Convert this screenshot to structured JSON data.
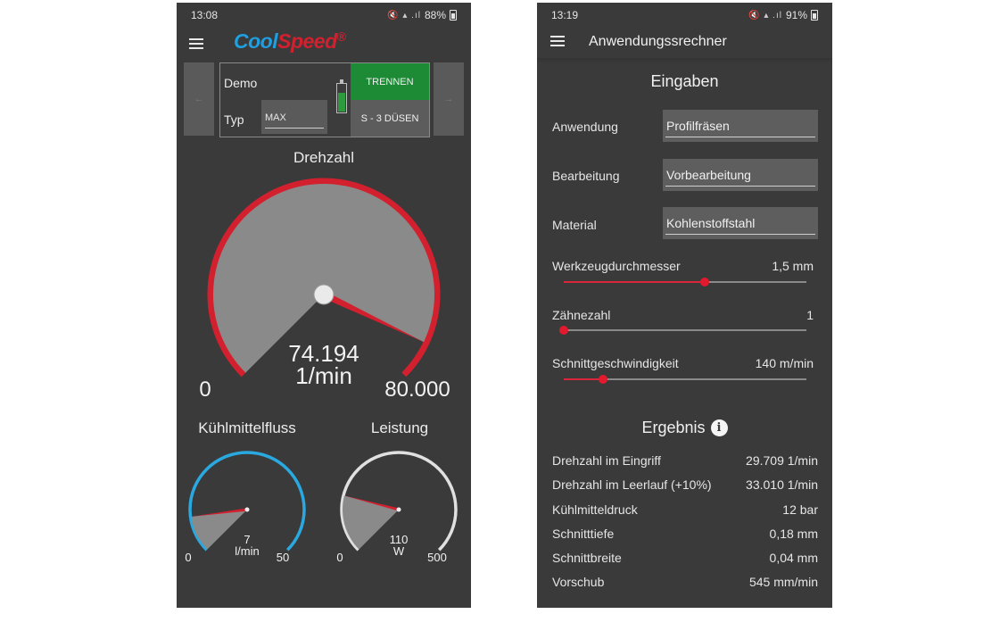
{
  "screen1": {
    "status": {
      "time": "13:08",
      "battery": "88%"
    },
    "brand": {
      "part1": "Cool",
      "part2": "Speed",
      "reg": "®"
    },
    "nav": {
      "prev": "←",
      "next": "→"
    },
    "device": {
      "name": "Demo",
      "type_label": "Typ",
      "type_value": "MAX",
      "disconnect_button": "TRENNEN",
      "nozzle_button": "S - 3 DÜSEN",
      "battery_level": 0.7
    },
    "rpm_gauge": {
      "title": "Drehzahl",
      "value": 74194,
      "value_text": "74.194",
      "unit": "1/min",
      "min": 0,
      "min_text": "0",
      "max": 80000,
      "max_text": "80.000"
    },
    "coolant_gauge": {
      "title": "Kühlmittelfluss",
      "value": 7,
      "value_text": "7",
      "unit": "l/min",
      "min": 0,
      "min_text": "0",
      "max": 50,
      "max_text": "50"
    },
    "power_gauge": {
      "title": "Leistung",
      "value": 110,
      "value_text": "110",
      "unit": "W",
      "min": 0,
      "min_text": "0",
      "max": 500,
      "max_text": "500"
    },
    "colors": {
      "accent_red": "#d3202f",
      "coolant_blue": "#2aa8e0",
      "power_white": "#e0e0e0",
      "gauge_fill": "#8a8a8a"
    }
  },
  "screen2": {
    "status": {
      "time": "13:19",
      "battery": "91%"
    },
    "title": "Anwendungssrechner",
    "inputs_title": "Eingaben",
    "fields": [
      {
        "label": "Anwendung",
        "value": "Profilfräsen"
      },
      {
        "label": "Bearbeitung",
        "value": "Vorbearbeitung"
      },
      {
        "label": "Material",
        "value": "Kohlenstoffstahl"
      }
    ],
    "sliders": [
      {
        "label": "Werkzeugdurchmesser",
        "value": "1,5 mm",
        "fraction": 0.58
      },
      {
        "label": "Zähnezahl",
        "value": "1",
        "fraction": 0.0
      },
      {
        "label": "Schnittgeschwindigkeit",
        "value": "140 m/min",
        "fraction": 0.16
      }
    ],
    "result_title": "Ergebnis",
    "info_icon": "i",
    "results": [
      {
        "label": "Drehzahl im Eingriff",
        "value": "29.709 1/min"
      },
      {
        "label": "Drehzahl im Leerlauf (+10%)",
        "value": "33.010 1/min"
      },
      {
        "label": "Kühlmitteldruck",
        "value": "12 bar"
      },
      {
        "label": "Schnitttiefe",
        "value": "0,18 mm"
      },
      {
        "label": "Schnittbreite",
        "value": "0,04 mm"
      },
      {
        "label": "Vorschub",
        "value": "545 mm/min"
      }
    ]
  }
}
